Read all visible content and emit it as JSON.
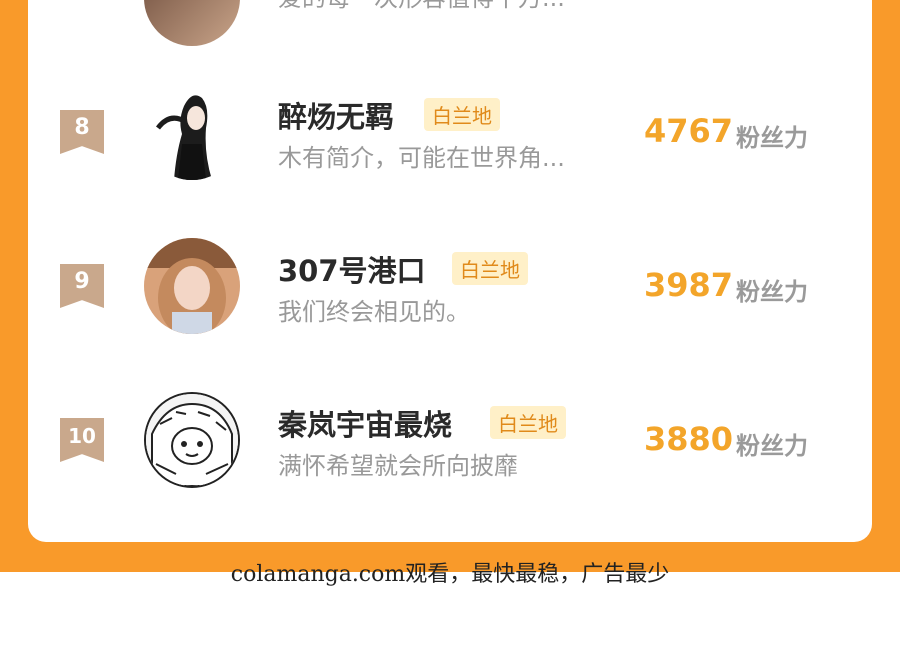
{
  "rows": [
    {
      "name": "",
      "desc": "爱的每一次形容值得千万...",
      "score": "",
      "score_label": ""
    },
    {
      "rank": "8",
      "name": "醉炀无羁",
      "tag": "白兰地",
      "desc": "木有简介，可能在世界角...",
      "score": "4767",
      "score_label": "粉丝力"
    },
    {
      "rank": "9",
      "name": "307号港口",
      "tag": "白兰地",
      "desc": "我们终会相见的。",
      "score": "3987",
      "score_label": "粉丝力"
    },
    {
      "rank": "10",
      "name": "秦岚宇宙最烧",
      "tag": "白兰地",
      "desc": "满怀希望就会所向披靡",
      "score": "3880",
      "score_label": "粉丝力"
    }
  ],
  "footer": "colamanga.com观看，最快最稳，广告最少",
  "colors": {
    "background_orange": "#f99a2a",
    "score": "#f3a52a",
    "tag_bg": "#fff0c8",
    "rank_badge": "#c9a88c"
  },
  "icons": [
    "rank-badge-icon",
    "avatar"
  ]
}
